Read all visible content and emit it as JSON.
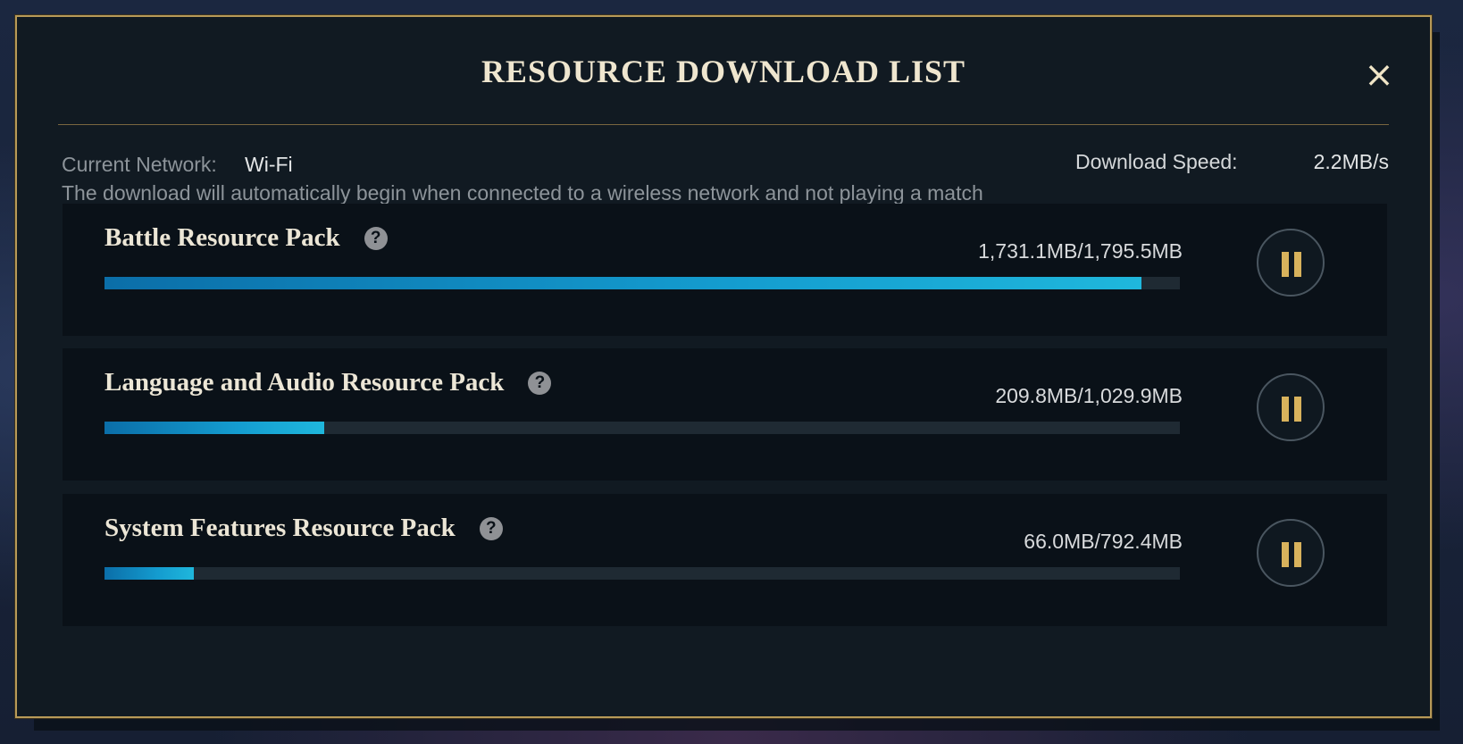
{
  "dialog": {
    "title": "RESOURCE DOWNLOAD LIST",
    "close_icon": "×"
  },
  "network": {
    "label": "Current Network:",
    "value": "Wi-Fi",
    "speed_label": "Download Speed:",
    "speed_value": "2.2MB/s",
    "note": "The download will automatically begin when connected to a wireless network and not playing a match"
  },
  "packs": [
    {
      "name": "Battle Resource Pack",
      "size_text": "1,731.1MB/1,795.5MB",
      "progress": 0.964,
      "help_icon": "?"
    },
    {
      "name": "Language and Audio Resource Pack",
      "size_text": "209.8MB/1,029.9MB",
      "progress": 0.204,
      "help_icon": "?"
    },
    {
      "name": "System Features Resource Pack",
      "size_text": "66.0MB/792.4MB",
      "progress": 0.083,
      "help_icon": "?"
    }
  ],
  "colors": {
    "accent_gold": "#b89a58",
    "progress_blue": "#1fb7dc",
    "pause_icon_gold": "#d8b25c"
  },
  "icons": {
    "close": "close-icon",
    "help": "question-mark-icon",
    "pause": "pause-icon"
  }
}
